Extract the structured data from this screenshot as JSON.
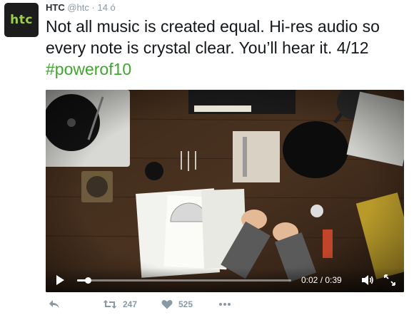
{
  "author": {
    "avatar_text": "htc",
    "name": "HTC",
    "handle": "@htc",
    "separator": "·",
    "time": "14 ó"
  },
  "tweet": {
    "text": "Not all music is created equal. Hi-res audio so every note is crystal clear. You’ll hear it. 4/12 ",
    "hashtag": "#powerof10"
  },
  "video": {
    "current_time": "0:02",
    "duration": "0:39",
    "time_separator": " / ",
    "progress_fraction": 0.05
  },
  "actions": {
    "retweet_count": "247",
    "like_count": "525"
  },
  "colors": {
    "hashtag": "#3fa72e",
    "avatar_bg": "#1c1c1c",
    "avatar_text": "#9ccf4a",
    "muted": "#8899a6"
  },
  "icons": {
    "reply": "reply-icon",
    "retweet": "retweet-icon",
    "like": "heart-icon",
    "more": "more-icon",
    "play": "play-icon",
    "volume": "volume-icon",
    "fullscreen": "fullscreen-icon"
  }
}
